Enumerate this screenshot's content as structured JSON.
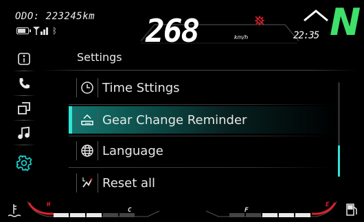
{
  "status": {
    "odometer": "ODO: 223245km",
    "speed": "268",
    "speed_unit": "km/h",
    "clock": "22:35",
    "gear": "N",
    "bluetooth_glyph": "ᛒ"
  },
  "sidebar": {
    "items": [
      {
        "icon": "info-icon",
        "active": false
      },
      {
        "icon": "phone-icon",
        "active": false
      },
      {
        "icon": "copy-icon",
        "active": false
      },
      {
        "icon": "music-note-icon",
        "active": false
      },
      {
        "icon": "gear-settings-icon",
        "active": true
      }
    ]
  },
  "menu": {
    "title": "Settings",
    "items": [
      {
        "label": "Time Sttings",
        "icon": "clock-icon",
        "selected": false
      },
      {
        "label": "Gear Change Reminder",
        "icon": "gear-shift-icon",
        "selected": true
      },
      {
        "label": "Language",
        "icon": "globe-icon",
        "selected": false
      },
      {
        "label": "Reset all",
        "icon": "reset-icon",
        "selected": false
      }
    ],
    "scroll_position": 0.75
  },
  "gauges": {
    "temp_hot": "H",
    "temp_cold": "C",
    "fuel_full": "F",
    "fuel_empty": "E"
  },
  "colors": {
    "accent": "#2ee6d8",
    "gear": "#3fe06a",
    "warning": "#e0202a"
  }
}
